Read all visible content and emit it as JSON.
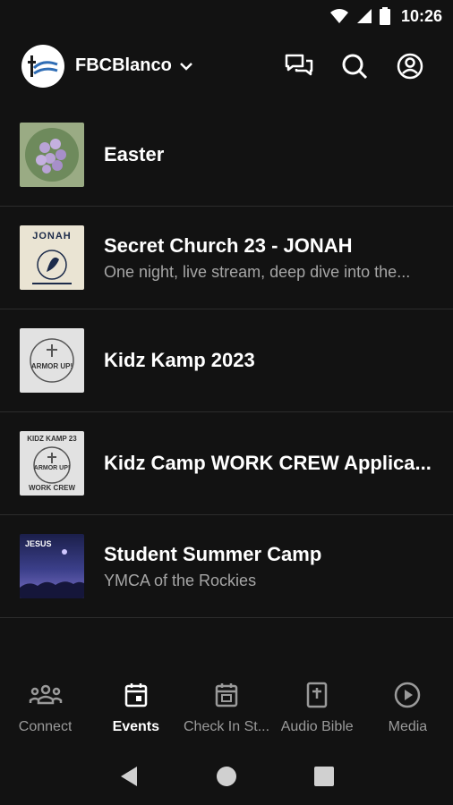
{
  "status_bar": {
    "time": "10:26"
  },
  "header": {
    "church_name": "FBCBlanco"
  },
  "events": [
    {
      "title": "Easter",
      "subtitle": ""
    },
    {
      "title": "Secret Church 23 - JONAH",
      "subtitle": "One night, live stream, deep dive into the..."
    },
    {
      "title": "Kidz Kamp 2023",
      "subtitle": ""
    },
    {
      "title": "Kidz Camp WORK CREW Applica...",
      "subtitle": ""
    },
    {
      "title": "Student Summer Camp",
      "subtitle": "YMCA of the Rockies"
    }
  ],
  "thumb_text": {
    "jonah": "JONAH",
    "armor": "ARMOR UP!",
    "kidz_kamp": "KIDZ KAMP 23",
    "work_crew": "WORK CREW",
    "jesus": "JESUS"
  },
  "tabs": [
    {
      "label": "Connect",
      "icon": "people-icon"
    },
    {
      "label": "Events",
      "icon": "calendar-icon"
    },
    {
      "label": "Check In St...",
      "icon": "calendar-check-icon"
    },
    {
      "label": "Audio Bible",
      "icon": "bible-icon"
    },
    {
      "label": "Media",
      "icon": "play-circle-icon"
    }
  ],
  "colors": {
    "background": "#121212",
    "divider": "#2c2c2c",
    "inactive": "#9a9a9a",
    "active": "#ffffff",
    "logo_blue": "#2f6db5"
  }
}
